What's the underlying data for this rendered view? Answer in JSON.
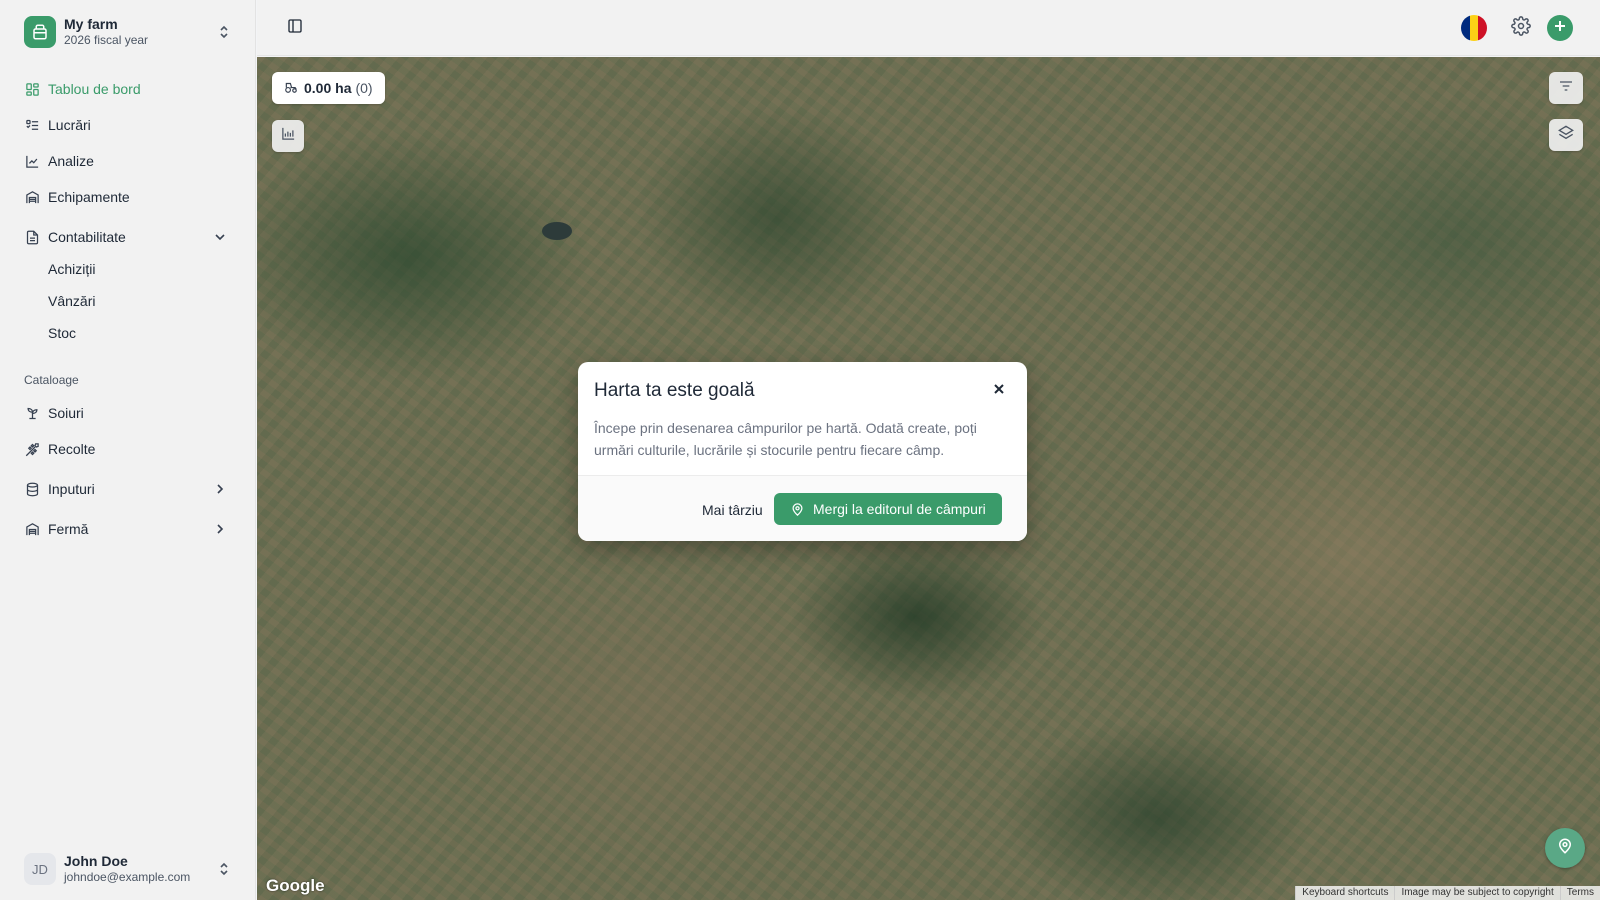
{
  "farm": {
    "name": "My farm",
    "year": "2026 fiscal year"
  },
  "nav": {
    "dashboard": "Tablou de bord",
    "works": "Lucrări",
    "analyses": "Analize",
    "equipment": "Echipamente",
    "accounting": "Contabilitate",
    "purchases": "Achiziții",
    "sales": "Vânzări",
    "stock": "Stoc",
    "catalogs_label": "Cataloage",
    "varieties": "Soiuri",
    "harvests": "Recolte",
    "inputs": "Inputuri",
    "farm": "Fermă"
  },
  "user": {
    "initials": "JD",
    "name": "John Doe",
    "email": "johndoe@example.com"
  },
  "map": {
    "area_value": "0.00 ha",
    "area_count": "(0)",
    "google_label": "Google",
    "attribution": {
      "shortcuts": "Keyboard shortcuts",
      "copyright": "Image may be subject to copyright",
      "terms": "Terms"
    }
  },
  "modal": {
    "title": "Harta ta este goală",
    "body": "Începe prin desenarea câmpurilor pe hartă. Odată create, poți urmări culturile, lucrările și stocurile pentru fiecare câmp.",
    "later_button": "Mai târziu",
    "editor_button": "Mergi la editorul de câmpuri"
  },
  "colors": {
    "accent": "#3a9b6a",
    "flag": [
      "#002b7f",
      "#fcd116",
      "#ce1126"
    ]
  },
  "icons": [
    "farm-logo-icon",
    "dashboard-icon",
    "list-icon",
    "chart-icon",
    "equipment-icon",
    "document-icon",
    "sprout-icon",
    "wheat-icon",
    "database-icon",
    "building-icon",
    "sidebar-toggle-icon",
    "gear-icon",
    "plus-icon",
    "close-icon",
    "map-pin-icon",
    "filter-icon",
    "layers-icon",
    "tractor-icon"
  ]
}
